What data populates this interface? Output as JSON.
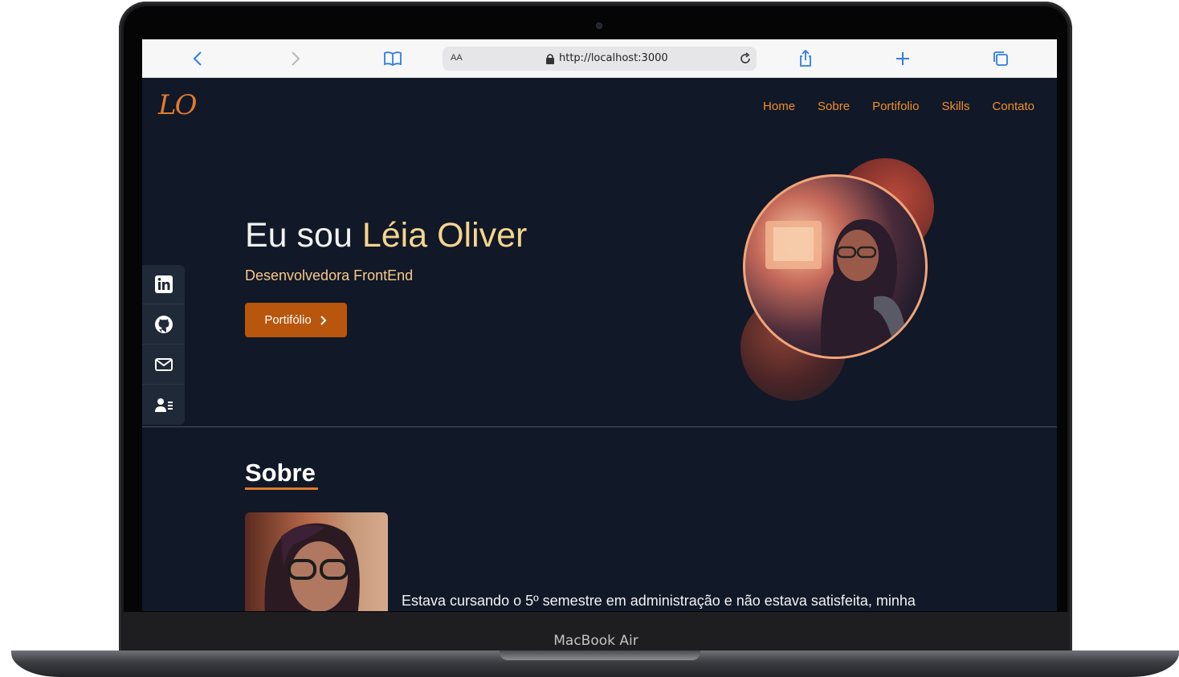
{
  "device": {
    "label": "MacBook Air"
  },
  "browser": {
    "aa_label": "AA",
    "url": "http://localhost:3000"
  },
  "site": {
    "logo": "LO",
    "nav": [
      "Home",
      "Sobre",
      "Portifolio",
      "Skills",
      "Contato"
    ],
    "hero": {
      "title_prefix": "Eu sou ",
      "title_name": "Léia Oliver",
      "subtitle": "Desenvolvedora FrontEnd",
      "button_label": "Portifólio"
    },
    "social_icons": [
      "linkedin-icon",
      "github-icon",
      "mail-icon",
      "contact-card-icon"
    ],
    "about": {
      "title": "Sobre",
      "text": "Estava cursando o 5º semestre em administração e não estava satisfeita, minha"
    }
  },
  "colors": {
    "accent": "#e07a2e",
    "button": "#b9560d",
    "highlight": "#f4d58d",
    "background": "#111827"
  }
}
